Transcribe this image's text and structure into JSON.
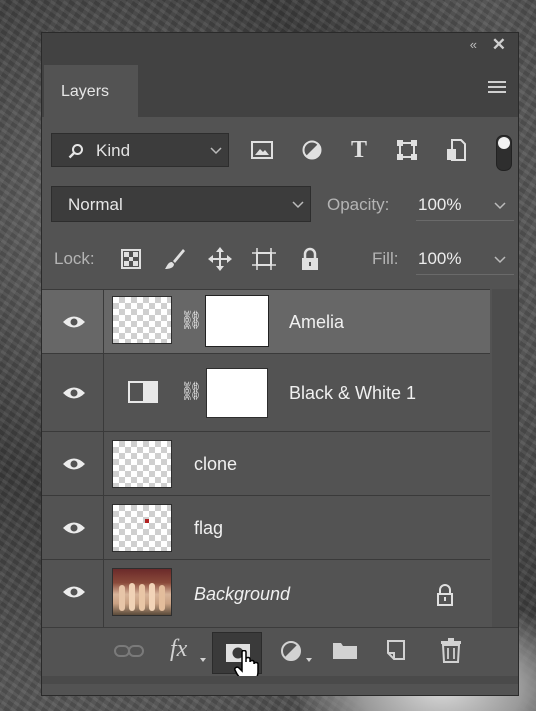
{
  "panel": {
    "tab_label": "Layers",
    "collapse_glyph": "«",
    "close_glyph": "✕"
  },
  "filter": {
    "kind_label": "Kind",
    "icons": [
      "image-filter-icon",
      "adjustment-filter-icon",
      "type-filter-icon",
      "shape-filter-icon",
      "smart-object-filter-icon"
    ]
  },
  "blend": {
    "mode": "Normal",
    "opacity_label": "Opacity:",
    "opacity_value": "100%"
  },
  "lock": {
    "label": "Lock:",
    "fill_label": "Fill:",
    "fill_value": "100%"
  },
  "layers": [
    {
      "name": "Amelia",
      "selected": true,
      "has_mask": true,
      "italic": false
    },
    {
      "name": "Black & White 1",
      "selected": false,
      "adjustment": true,
      "has_mask": true,
      "italic": false
    },
    {
      "name": "clone",
      "selected": false,
      "italic": false
    },
    {
      "name": "flag",
      "selected": false,
      "italic": false
    },
    {
      "name": "Background",
      "selected": false,
      "italic": true,
      "locked": true
    }
  ],
  "bottom_bar": {
    "fx_label": "fx"
  },
  "colors": {
    "panel_bg": "#535353",
    "selected_row": "#676767",
    "dark_bar": "#424242"
  }
}
